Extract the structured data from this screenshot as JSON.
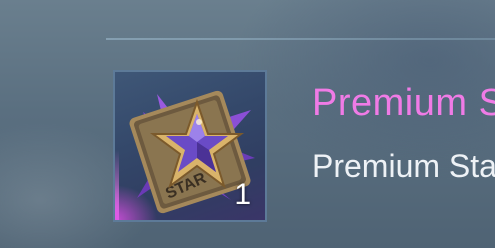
{
  "item": {
    "title": "Premium S",
    "subtitle": "Premium Sta",
    "count": "1",
    "icon": "premium-star-card-icon",
    "rarity_color": "#f07be6"
  }
}
